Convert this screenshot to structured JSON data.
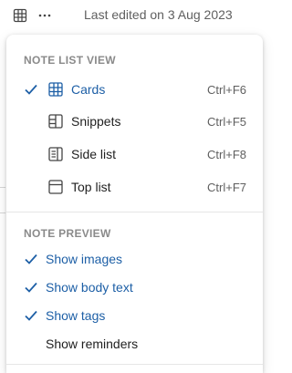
{
  "toolbar": {
    "view_icon": "grid-icon",
    "more_icon": "more-horizontal-icon",
    "edited_text": "Last edited on 3 Aug 2023"
  },
  "menu": {
    "note_list_view": {
      "header": "NOTE LIST VIEW",
      "items": [
        {
          "label": "Cards",
          "shortcut": "Ctrl+F6",
          "checked": true,
          "icon": "cards-icon"
        },
        {
          "label": "Snippets",
          "shortcut": "Ctrl+F5",
          "checked": false,
          "icon": "snippets-icon"
        },
        {
          "label": "Side list",
          "shortcut": "Ctrl+F8",
          "checked": false,
          "icon": "side-list-icon"
        },
        {
          "label": "Top list",
          "shortcut": "Ctrl+F7",
          "checked": false,
          "icon": "top-list-icon"
        }
      ]
    },
    "note_preview": {
      "header": "NOTE PREVIEW",
      "items": [
        {
          "label": "Show images",
          "checked": true
        },
        {
          "label": "Show body text",
          "checked": true
        },
        {
          "label": "Show tags",
          "checked": true
        },
        {
          "label": "Show reminders",
          "checked": false
        }
      ]
    }
  },
  "colors": {
    "accent": "#1d5fa6",
    "text": "#1f1f1f",
    "muted": "#5f5f5f",
    "header": "#8a8a8a"
  }
}
